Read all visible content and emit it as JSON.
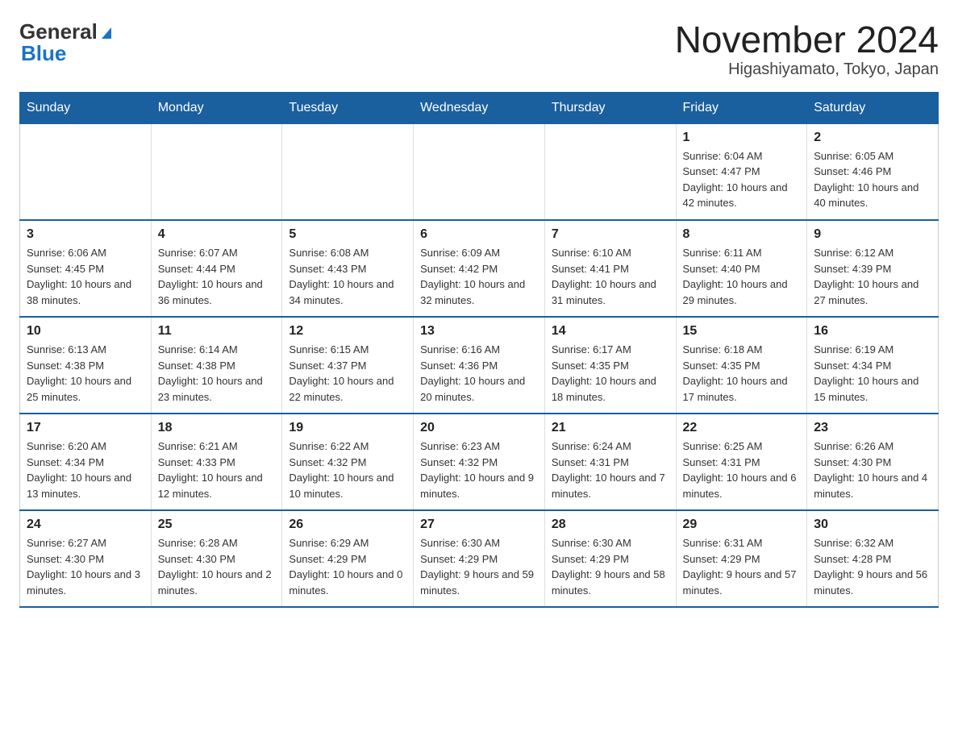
{
  "header": {
    "logo_general": "General",
    "logo_blue": "Blue",
    "title": "November 2024",
    "subtitle": "Higashiyamato, Tokyo, Japan"
  },
  "days_of_week": [
    "Sunday",
    "Monday",
    "Tuesday",
    "Wednesday",
    "Thursday",
    "Friday",
    "Saturday"
  ],
  "weeks": [
    [
      {
        "day": "",
        "info": ""
      },
      {
        "day": "",
        "info": ""
      },
      {
        "day": "",
        "info": ""
      },
      {
        "day": "",
        "info": ""
      },
      {
        "day": "",
        "info": ""
      },
      {
        "day": "1",
        "info": "Sunrise: 6:04 AM\nSunset: 4:47 PM\nDaylight: 10 hours and 42 minutes."
      },
      {
        "day": "2",
        "info": "Sunrise: 6:05 AM\nSunset: 4:46 PM\nDaylight: 10 hours and 40 minutes."
      }
    ],
    [
      {
        "day": "3",
        "info": "Sunrise: 6:06 AM\nSunset: 4:45 PM\nDaylight: 10 hours and 38 minutes."
      },
      {
        "day": "4",
        "info": "Sunrise: 6:07 AM\nSunset: 4:44 PM\nDaylight: 10 hours and 36 minutes."
      },
      {
        "day": "5",
        "info": "Sunrise: 6:08 AM\nSunset: 4:43 PM\nDaylight: 10 hours and 34 minutes."
      },
      {
        "day": "6",
        "info": "Sunrise: 6:09 AM\nSunset: 4:42 PM\nDaylight: 10 hours and 32 minutes."
      },
      {
        "day": "7",
        "info": "Sunrise: 6:10 AM\nSunset: 4:41 PM\nDaylight: 10 hours and 31 minutes."
      },
      {
        "day": "8",
        "info": "Sunrise: 6:11 AM\nSunset: 4:40 PM\nDaylight: 10 hours and 29 minutes."
      },
      {
        "day": "9",
        "info": "Sunrise: 6:12 AM\nSunset: 4:39 PM\nDaylight: 10 hours and 27 minutes."
      }
    ],
    [
      {
        "day": "10",
        "info": "Sunrise: 6:13 AM\nSunset: 4:38 PM\nDaylight: 10 hours and 25 minutes."
      },
      {
        "day": "11",
        "info": "Sunrise: 6:14 AM\nSunset: 4:38 PM\nDaylight: 10 hours and 23 minutes."
      },
      {
        "day": "12",
        "info": "Sunrise: 6:15 AM\nSunset: 4:37 PM\nDaylight: 10 hours and 22 minutes."
      },
      {
        "day": "13",
        "info": "Sunrise: 6:16 AM\nSunset: 4:36 PM\nDaylight: 10 hours and 20 minutes."
      },
      {
        "day": "14",
        "info": "Sunrise: 6:17 AM\nSunset: 4:35 PM\nDaylight: 10 hours and 18 minutes."
      },
      {
        "day": "15",
        "info": "Sunrise: 6:18 AM\nSunset: 4:35 PM\nDaylight: 10 hours and 17 minutes."
      },
      {
        "day": "16",
        "info": "Sunrise: 6:19 AM\nSunset: 4:34 PM\nDaylight: 10 hours and 15 minutes."
      }
    ],
    [
      {
        "day": "17",
        "info": "Sunrise: 6:20 AM\nSunset: 4:34 PM\nDaylight: 10 hours and 13 minutes."
      },
      {
        "day": "18",
        "info": "Sunrise: 6:21 AM\nSunset: 4:33 PM\nDaylight: 10 hours and 12 minutes."
      },
      {
        "day": "19",
        "info": "Sunrise: 6:22 AM\nSunset: 4:32 PM\nDaylight: 10 hours and 10 minutes."
      },
      {
        "day": "20",
        "info": "Sunrise: 6:23 AM\nSunset: 4:32 PM\nDaylight: 10 hours and 9 minutes."
      },
      {
        "day": "21",
        "info": "Sunrise: 6:24 AM\nSunset: 4:31 PM\nDaylight: 10 hours and 7 minutes."
      },
      {
        "day": "22",
        "info": "Sunrise: 6:25 AM\nSunset: 4:31 PM\nDaylight: 10 hours and 6 minutes."
      },
      {
        "day": "23",
        "info": "Sunrise: 6:26 AM\nSunset: 4:30 PM\nDaylight: 10 hours and 4 minutes."
      }
    ],
    [
      {
        "day": "24",
        "info": "Sunrise: 6:27 AM\nSunset: 4:30 PM\nDaylight: 10 hours and 3 minutes."
      },
      {
        "day": "25",
        "info": "Sunrise: 6:28 AM\nSunset: 4:30 PM\nDaylight: 10 hours and 2 minutes."
      },
      {
        "day": "26",
        "info": "Sunrise: 6:29 AM\nSunset: 4:29 PM\nDaylight: 10 hours and 0 minutes."
      },
      {
        "day": "27",
        "info": "Sunrise: 6:30 AM\nSunset: 4:29 PM\nDaylight: 9 hours and 59 minutes."
      },
      {
        "day": "28",
        "info": "Sunrise: 6:30 AM\nSunset: 4:29 PM\nDaylight: 9 hours and 58 minutes."
      },
      {
        "day": "29",
        "info": "Sunrise: 6:31 AM\nSunset: 4:29 PM\nDaylight: 9 hours and 57 minutes."
      },
      {
        "day": "30",
        "info": "Sunrise: 6:32 AM\nSunset: 4:28 PM\nDaylight: 9 hours and 56 minutes."
      }
    ]
  ]
}
